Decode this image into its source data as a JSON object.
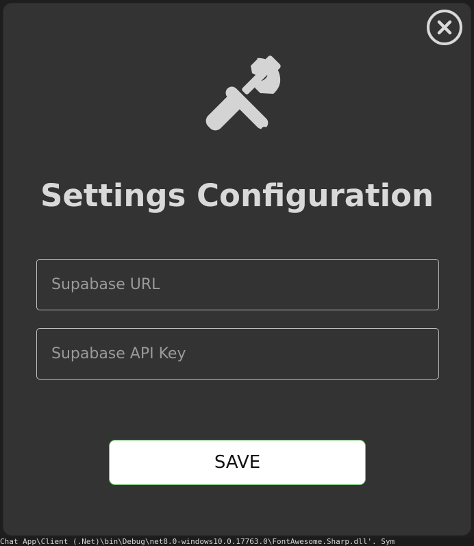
{
  "dialog": {
    "title": "Settings Configuration",
    "close_icon": "close-circle-icon",
    "header_icon": "screwdriver-wrench-icon"
  },
  "fields": {
    "supabase_url": {
      "value": "",
      "placeholder": "Supabase URL"
    },
    "supabase_api_key": {
      "value": "",
      "placeholder": "Supabase API Key"
    }
  },
  "actions": {
    "save_label": "SAVE"
  },
  "background": {
    "status_text": "Chat App\\Client (.Net)\\bin\\Debug\\net8.0-windows10.0.17763.0\\FontAwesome.Sharp.dll'. Sym"
  },
  "colors": {
    "dialog_bg": "#333333",
    "foreground": "#d9d9d9",
    "save_border": "#6fbf6f"
  }
}
